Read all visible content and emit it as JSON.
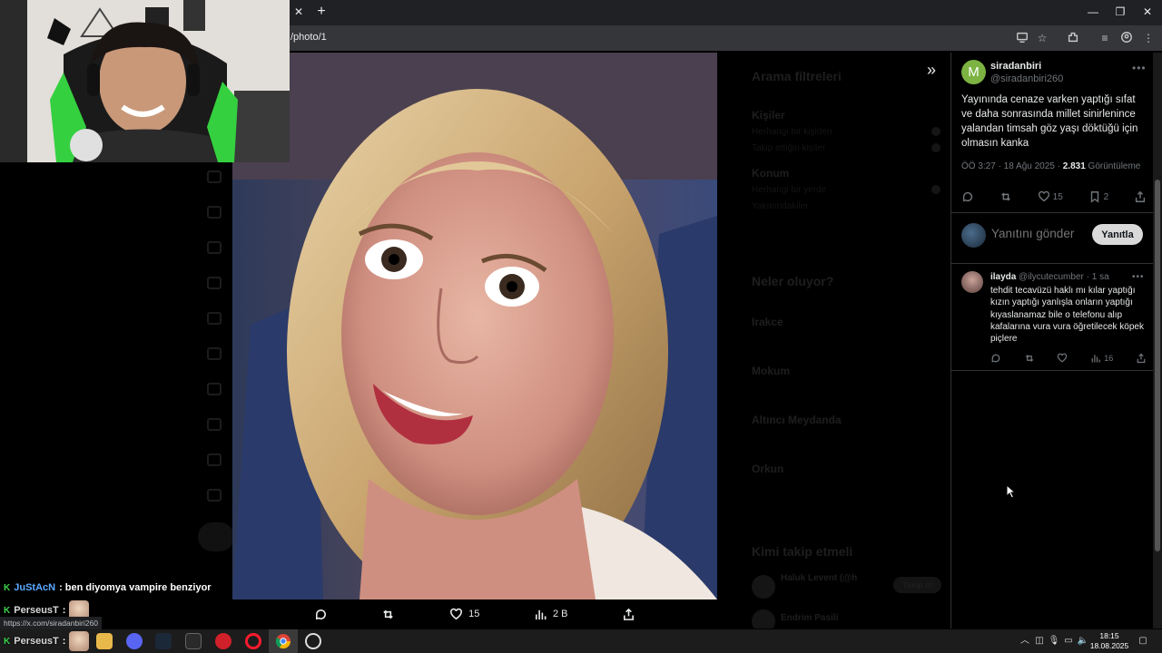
{
  "browser": {
    "url": "/photo/1",
    "status_url": "https://x.com/siradanbiri260"
  },
  "photo_actions": {
    "likes": "15",
    "views": "2 B"
  },
  "background_filters": {
    "title": "Arama filtreleri",
    "people": "Kişiler",
    "anyone": "Herhangi bir kişiden",
    "following": "Takip ettiğin kişiler",
    "location": "Konum",
    "anywhere": "Herhangi bir yerde",
    "near": "Yakınındakiler",
    "trending_title": "Neler oluyor?",
    "trend1": "Irakce",
    "trend2": "Mokum",
    "trend3": "Altıncı Meydanda",
    "trend4": "Orkun",
    "follow_title": "Kimi takip etmeli",
    "follow1": "Haluk Levent (@h",
    "follow2": "Endrim Pasili",
    "follow_btn": "Takip et"
  },
  "tweet": {
    "avatar_letter": "M",
    "author": "siradanbiri",
    "handle": "@siradanbiri260",
    "text": "Yayınında cenaze varken yaptığı sıfat ve daha sonrasında millet sinirlenince yalandan timsah göz yaşı döktüğü için olmasın kanka",
    "time": "ÖÖ 3:27 · 18 Ağu 2025 · ",
    "views_count": "2.831",
    "views_label": " Görüntüleme",
    "likes": "15",
    "bookmarks": "2"
  },
  "reply_box": {
    "placeholder": "Yanıtını gönder",
    "button": "Yanıtla"
  },
  "reply": {
    "name": "ilayda",
    "handle": "@ilycutecumber · 1 sa",
    "text": "tehdit tecavüzü haklı mı kılar yaptığı kızın yaptığı yanlışla onların yaptığı kıyaslanamaz bile o telefonu alıp kafalarına vura vura öğretilecek köpek piçlere",
    "views": "16"
  },
  "chat": [
    {
      "user": "JuStAcN",
      "message": ": ben diyomya vampire benziyor"
    },
    {
      "user": "PerseusT",
      "message": ":"
    },
    {
      "user": "PerseusT",
      "message": ":"
    }
  ],
  "taskbar": {
    "time": "18:15",
    "date": "18.08.2025"
  }
}
